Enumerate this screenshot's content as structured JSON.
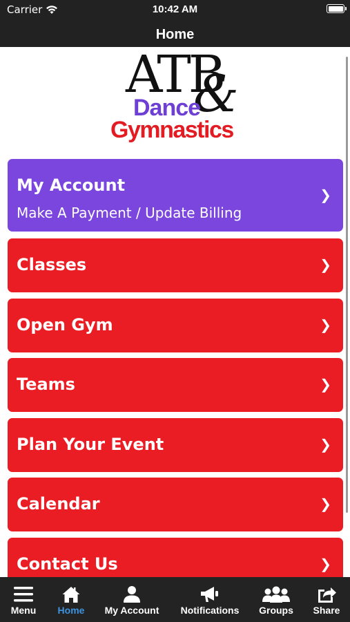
{
  "status_bar": {
    "carrier": "Carrier",
    "time": "10:42 AM"
  },
  "nav": {
    "title": "Home"
  },
  "logo": {
    "line1": "ATB",
    "ampersand": "&",
    "line2": "Dance",
    "line3": "Gymnastics"
  },
  "menu": {
    "my_account": {
      "title": "My Account",
      "subtitle": "Make A Payment / Update Billing",
      "color": "#7b46dd"
    },
    "items": [
      {
        "title": "Classes",
        "color": "#ea1c24"
      },
      {
        "title": "Open Gym",
        "color": "#ea1c24"
      },
      {
        "title": "Teams",
        "color": "#ea1c24"
      },
      {
        "title": "Plan Your Event",
        "color": "#ea1c24"
      },
      {
        "title": "Calendar",
        "color": "#ea1c24"
      },
      {
        "title": "Contact Us",
        "color": "#ea1c24"
      }
    ],
    "chevron": "❯"
  },
  "tab_bar": {
    "active_color": "#3d93e0",
    "tabs": [
      {
        "label": "Menu",
        "icon": "hamburger-icon",
        "active": false
      },
      {
        "label": "Home",
        "icon": "home-icon",
        "active": true
      },
      {
        "label": "My Account",
        "icon": "user-icon",
        "active": false
      },
      {
        "label": "Notifications",
        "icon": "megaphone-icon",
        "active": false
      },
      {
        "label": "Groups",
        "icon": "group-icon",
        "active": false
      },
      {
        "label": "Share",
        "icon": "share-icon",
        "active": false
      }
    ]
  }
}
